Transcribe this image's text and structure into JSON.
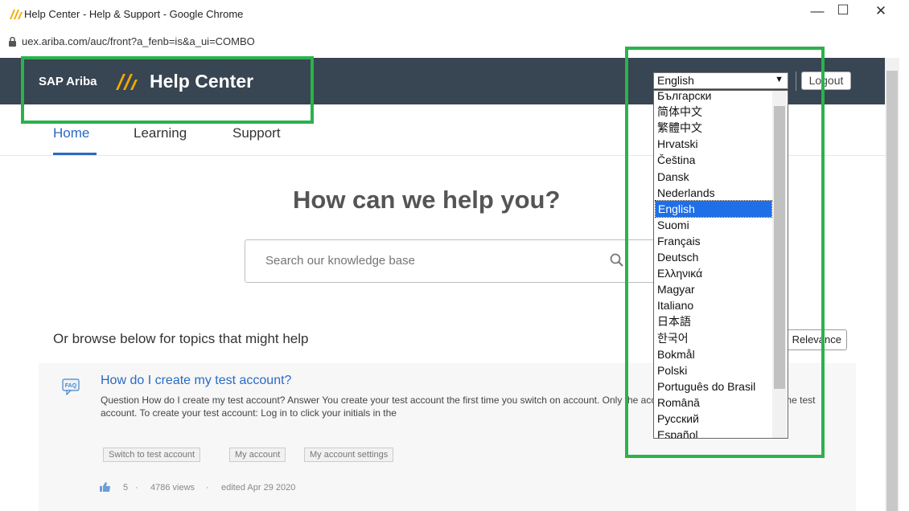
{
  "browser": {
    "title": "Help Center - Help & Support - Google Chrome",
    "url": "uex.ariba.com/auc/front?a_fenb=is&a_ui=COMBO",
    "minimize": "—",
    "maximize": "☐",
    "close": "✕"
  },
  "header": {
    "brand_sap": "SAP Ariba",
    "brand_title": "Help Center",
    "language_selected": "English",
    "logout_label": "Logout"
  },
  "nav": {
    "tabs": [
      {
        "label": "Home",
        "active": true
      },
      {
        "label": "Learning",
        "active": false
      },
      {
        "label": "Support",
        "active": false
      }
    ]
  },
  "main": {
    "hero": "How can we help you?",
    "search_placeholder": "Search our knowledge base",
    "browse_text": "Or browse below for topics that might help",
    "sort_value": "Relevance"
  },
  "card": {
    "title": "How do I create my test account?",
    "body": "Question How do I create my test account? Answer You create your test account the first time you switch on account. Only the account administrator can create the test account. To create your test account: Log in to click your initials in the",
    "tags": [
      "Switch to test account",
      "My account",
      "My account settings"
    ],
    "likes": "5",
    "views": "4786 views",
    "edited": "edited Apr 29 2020"
  },
  "languages": [
    "Български",
    "简体中文",
    "繁體中文",
    "Hrvatski",
    "Čeština",
    "Dansk",
    "Nederlands",
    "English",
    "Suomi",
    "Français",
    "Deutsch",
    "Ελληνικά",
    "Magyar",
    "Italiano",
    "日本語",
    "한국어",
    "Bokmål",
    "Polski",
    "Português do Brasil",
    "Română",
    "Русский",
    "Español"
  ],
  "selected_language_index": 7,
  "colors": {
    "header_bg": "#384552",
    "accent": "#2a6ac2",
    "highlight": "#2bb24c",
    "selection": "#1e6fe8"
  }
}
